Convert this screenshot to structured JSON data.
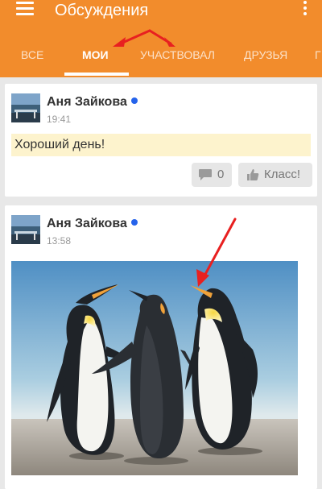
{
  "appbar": {
    "title": "Обсуждения",
    "menu_icon": "hamburger-menu-icon",
    "more_icon": "more-vertical-icon",
    "color": "#f28c2c"
  },
  "tabs": [
    {
      "label": "ВСЕ",
      "active": false
    },
    {
      "label": "МОИ",
      "active": true
    },
    {
      "label": "УЧАСТВОВАЛ",
      "active": false
    },
    {
      "label": "ДРУЗЬЯ",
      "active": false
    },
    {
      "label": "Г",
      "active": false
    }
  ],
  "posts": [
    {
      "author": "Аня Зайкова",
      "time": "19:41",
      "text": "Хороший день!",
      "comments_count": "0",
      "like_label": "Класс!"
    },
    {
      "author": "Аня Зайкова",
      "time": "13:58",
      "image": "penguins-photo"
    }
  ],
  "colors": {
    "online": "#2563eb",
    "annotation": "#e82020",
    "status_highlight": "#fdf3cd"
  }
}
